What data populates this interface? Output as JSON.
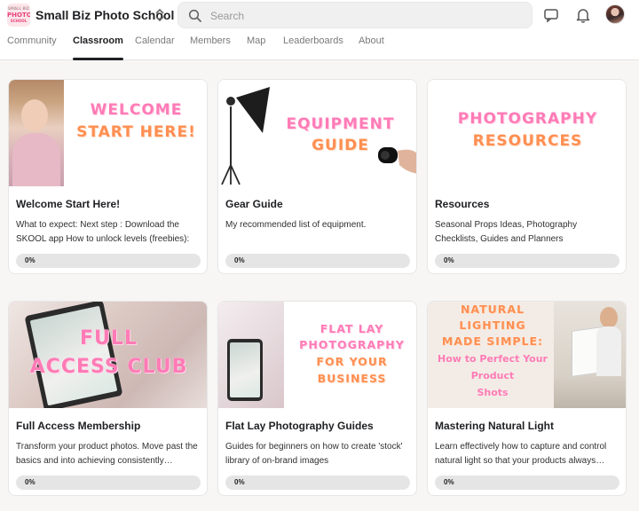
{
  "header": {
    "logo": {
      "line1": "SMALL BIZ",
      "line2": "PHOTO",
      "line3": "SCHOOL"
    },
    "site_title": "Small Biz Photo School",
    "search_placeholder": "Search",
    "icons": {
      "switcher": "chevron-updown-icon",
      "search": "search-icon",
      "chat": "chat-icon",
      "notifications": "bell-icon",
      "avatar": "user-avatar"
    }
  },
  "tabs": [
    {
      "label": "Community",
      "active": false
    },
    {
      "label": "Classroom",
      "active": true
    },
    {
      "label": "Calendar",
      "active": false
    },
    {
      "label": "Members",
      "active": false
    },
    {
      "label": "Map",
      "active": false
    },
    {
      "label": "Leaderboards",
      "active": false
    },
    {
      "label": "About",
      "active": false
    }
  ],
  "courses": [
    {
      "cover_lines": [
        "WELCOME",
        "START HERE!"
      ],
      "title": "Welcome Start Here!",
      "description": "What to expect: Next step : Download the SKOOL app How to unlock levels (freebies):",
      "progress": 0,
      "progress_label": "0%"
    },
    {
      "cover_lines": [
        "EQUIPMENT",
        "GUIDE"
      ],
      "title": "Gear Guide",
      "description": "My recommended list of equipment.",
      "progress": 0,
      "progress_label": "0%"
    },
    {
      "cover_lines": [
        "PHOTOGRAPHY",
        "RESOURCES"
      ],
      "title": "Resources",
      "description": "Seasonal Props Ideas, Photography Checklists, Guides and Planners",
      "progress": 0,
      "progress_label": "0%"
    },
    {
      "cover_lines": [
        "FULL",
        "ACCESS CLUB"
      ],
      "title": "Full Access Membership",
      "description": "Transform your product photos. Move past the basics and into achieving consistently…",
      "progress": 0,
      "progress_label": "0%"
    },
    {
      "cover_lines": [
        "FLAT LAY",
        "PHOTOGRAPHY",
        "FOR YOUR",
        "BUSINESS"
      ],
      "title": "Flat Lay Photography Guides",
      "description": "Guides for beginners on how to create 'stock' library of on-brand images",
      "progress": 0,
      "progress_label": "0%"
    },
    {
      "cover_lines": [
        "NATURAL",
        "LIGHTING",
        "MADE SIMPLE:"
      ],
      "cover_sublines": [
        "How to Perfect Your",
        "Product",
        "Shots"
      ],
      "title": "Mastering Natural Light",
      "description": "Learn effectively how to capture and control natural light so that your products always…",
      "progress": 0,
      "progress_label": "0%"
    }
  ],
  "colors": {
    "accent": "#ff7bb6",
    "orange": "#ff8f52",
    "progress_track": "#e5e5e5",
    "progress_fill": "#8bc34a"
  }
}
